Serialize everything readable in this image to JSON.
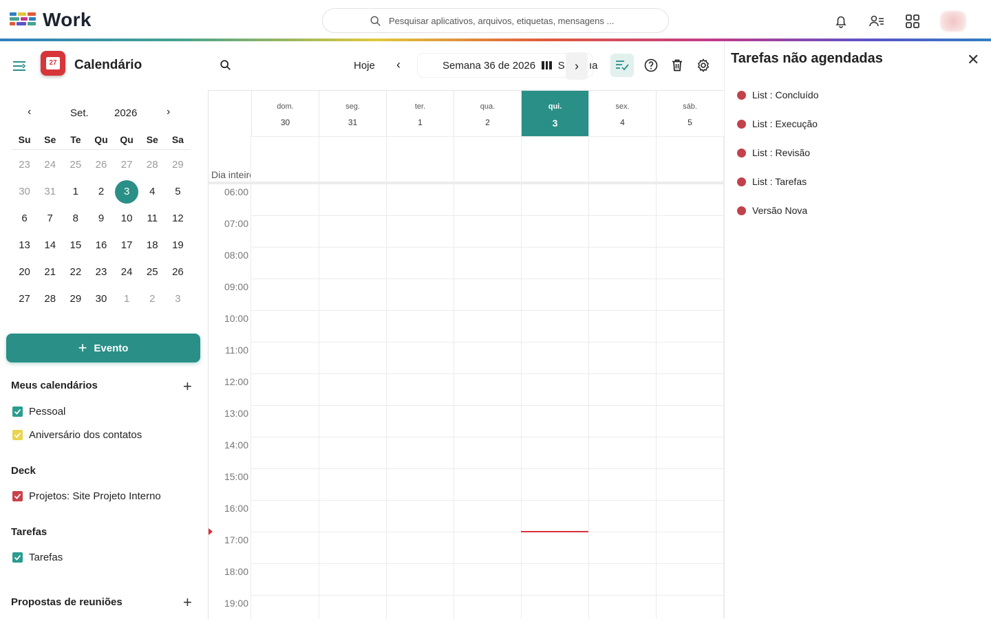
{
  "brand": {
    "name": "Work"
  },
  "search": {
    "placeholder": "Pesquisar aplicativos, arquivos, etiquetas, mensagens ..."
  },
  "app": {
    "title": "Calendário",
    "icon_day": "27"
  },
  "mini_calendar": {
    "month": "Set.",
    "year": "2026",
    "weekdays": [
      "Su",
      "Se",
      "Te",
      "Qu",
      "Qu",
      "Se",
      "Sa"
    ],
    "weeks": [
      [
        "23",
        "24",
        "25",
        "26",
        "27",
        "28",
        "29"
      ],
      [
        "30",
        "31",
        "1",
        "2",
        "3",
        "4",
        "5"
      ],
      [
        "6",
        "7",
        "8",
        "9",
        "10",
        "11",
        "12"
      ],
      [
        "13",
        "14",
        "15",
        "16",
        "17",
        "18",
        "19"
      ],
      [
        "20",
        "21",
        "22",
        "23",
        "24",
        "25",
        "26"
      ],
      [
        "27",
        "28",
        "29",
        "30",
        "1",
        "2",
        "3"
      ]
    ],
    "today": "3"
  },
  "new_event": {
    "label": "Evento"
  },
  "sections": {
    "my_calendars": {
      "title": "Meus calendários",
      "items": [
        {
          "label": "Pessoal",
          "color": "#2a9d8f"
        },
        {
          "label": "Aniversário dos contatos",
          "color": "#e9d54f"
        }
      ]
    },
    "deck": {
      "title": "Deck",
      "items": [
        {
          "label": "Projetos: Site Projeto Interno",
          "color": "#c9414b"
        }
      ]
    },
    "tasks": {
      "title": "Tarefas",
      "items": [
        {
          "label": "Tarefas",
          "color": "#2a9d8f"
        }
      ]
    },
    "proposals": {
      "title": "Propostas de reuniões"
    }
  },
  "toolbar": {
    "today_label": "Hoje",
    "week_label": "Semana 36 de 2026",
    "view_fragment_1": "S",
    "view_fragment_2": "ıa"
  },
  "week": {
    "days": [
      {
        "name": "dom.",
        "num": "30"
      },
      {
        "name": "seg.",
        "num": "31"
      },
      {
        "name": "ter.",
        "num": "1"
      },
      {
        "name": "qua.",
        "num": "2"
      },
      {
        "name": "qui.",
        "num": "3",
        "today": true
      },
      {
        "name": "sex.",
        "num": "4"
      },
      {
        "name": "sáb.",
        "num": "5"
      }
    ],
    "all_day_label": "Dia inteiro",
    "hours": [
      "06:00",
      "07:00",
      "08:00",
      "09:00",
      "10:00",
      "11:00",
      "12:00",
      "13:00",
      "14:00",
      "15:00",
      "16:00",
      "17:00",
      "18:00",
      "19:00"
    ],
    "now_time": "17:00"
  },
  "unscheduled": {
    "title": "Tarefas não agendadas",
    "items": [
      {
        "label": "List : Concluído"
      },
      {
        "label": "List : Execução"
      },
      {
        "label": "List : Revisão"
      },
      {
        "label": "List : Tarefas"
      },
      {
        "label": "Versão Nova"
      }
    ],
    "dot_color": "#c2414b"
  },
  "colors": {
    "accent": "#2a8f87",
    "now_line": "#d9303a"
  }
}
